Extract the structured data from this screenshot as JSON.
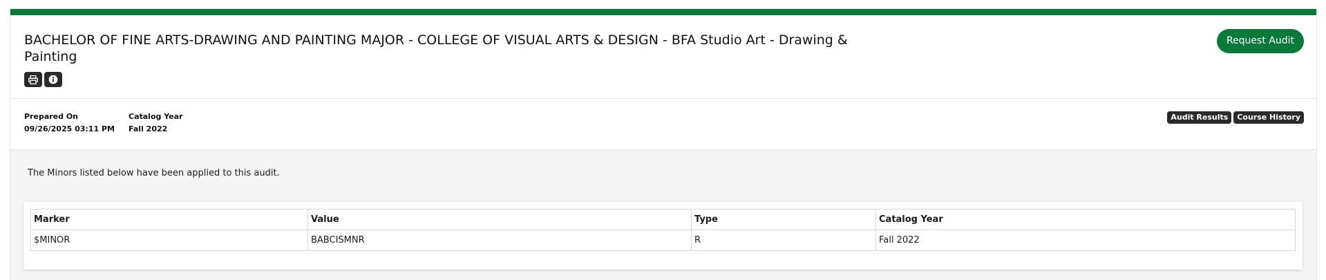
{
  "header": {
    "title": "BACHELOR OF FINE ARTS-DRAWING AND PAINTING MAJOR - COLLEGE OF VISUAL ARTS & DESIGN - BFA Studio Art - Drawing & Painting",
    "request_audit_label": "Request Audit",
    "icons": [
      "printer-icon",
      "info-icon"
    ]
  },
  "meta": {
    "prepared_on_label": "Prepared On",
    "prepared_on_value": "09/26/2025 03:11 PM",
    "catalog_year_label": "Catalog Year",
    "catalog_year_value": "Fall 2022",
    "audit_results_label": "Audit Results",
    "course_history_label": "Course History"
  },
  "body": {
    "notice": "The Minors listed below have been applied to this audit.",
    "table": {
      "columns": [
        "Marker",
        "Value",
        "Type",
        "Catalog Year"
      ],
      "rows": [
        [
          "$MINOR",
          "BABCISMNR",
          "R",
          "Fall 2022"
        ]
      ]
    }
  },
  "colors": {
    "brand_green": "#0a7a3a",
    "dark_pill": "#2b2b2b",
    "body_bg": "#f4f4f4"
  }
}
